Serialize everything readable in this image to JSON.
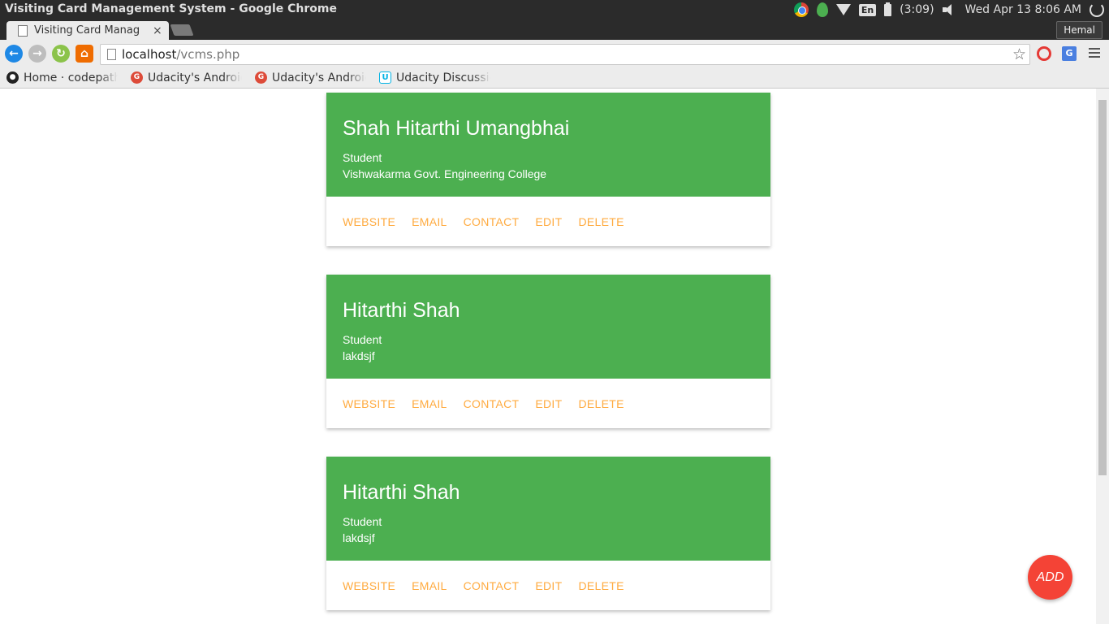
{
  "window": {
    "title": "Visiting Card Management System - Google Chrome"
  },
  "tray": {
    "lang": "En",
    "battery": "(3:09)",
    "datetime": "Wed Apr 13  8:06 AM"
  },
  "tabs": [
    {
      "label": "Visiting Card Manag",
      "close": "×"
    }
  ],
  "user": "Hemal",
  "address": {
    "host": "localhost",
    "path": "/vcms.php"
  },
  "bookmarks": [
    {
      "label": "Home · codepath",
      "icon": "github-icon"
    },
    {
      "label": "Udacity's Android",
      "icon": "google-plus-icon"
    },
    {
      "label": "Udacity's Android",
      "icon": "google-plus-icon"
    },
    {
      "label": "Udacity Discussio",
      "icon": "udacity-icon"
    }
  ],
  "cards": [
    {
      "name": "Shah Hitarthi Umangbhai",
      "role": "Student",
      "org": "Vishwakarma Govt. Engineering College"
    },
    {
      "name": "Hitarthi Shah",
      "role": "Student",
      "org": "lakdsjf"
    },
    {
      "name": "Hitarthi Shah",
      "role": "Student",
      "org": "lakdsjf"
    }
  ],
  "actions": {
    "website": "WEBSITE",
    "email": "EMAIL",
    "contact": "CONTACT",
    "edit": "EDIT",
    "delete": "DELETE"
  },
  "fab_label": "ADD",
  "colors": {
    "card_header": "#4caf50",
    "action_text": "#ffab40",
    "fab": "#f44336"
  }
}
